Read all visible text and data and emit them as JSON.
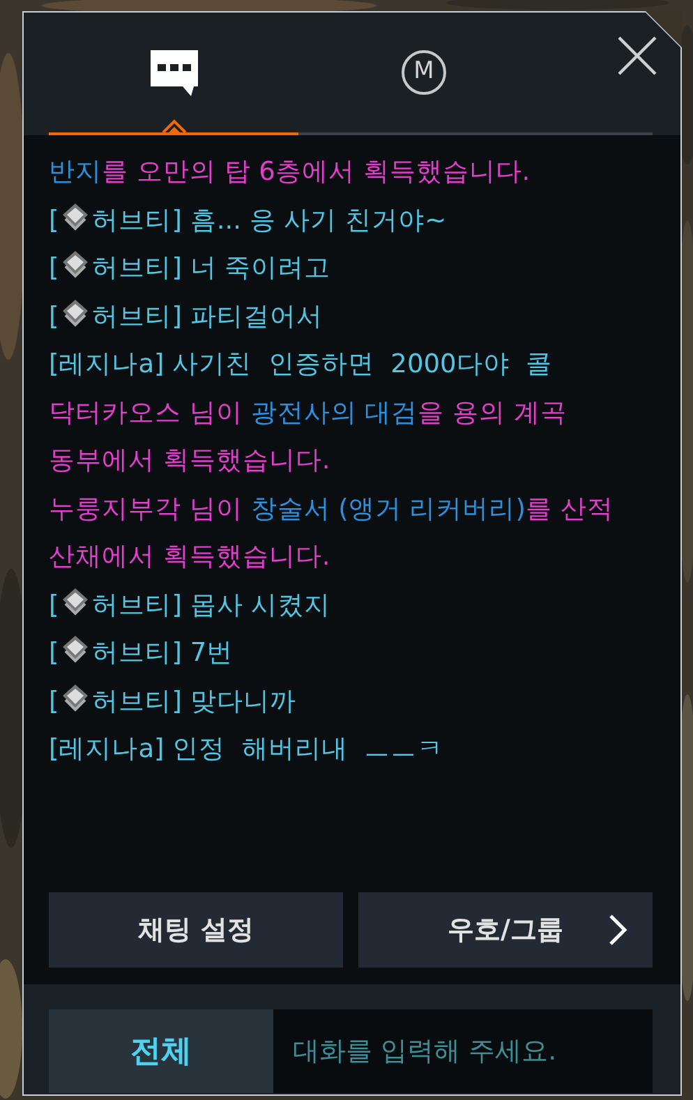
{
  "tabs": [
    {
      "kind": "chat",
      "selected": true
    },
    {
      "kind": "letter",
      "label": "M",
      "selected": false
    }
  ],
  "messages": [
    {
      "kind": "system",
      "segments": [
        {
          "text": "반지",
          "color": "#2e90dc"
        },
        {
          "text": "를 오만의 탑 6층에서 획득했습니다.",
          "color": "#e23fcb"
        }
      ]
    },
    {
      "kind": "chat",
      "rank_icon": true,
      "open": "[",
      "sender": "허브티]",
      "text": "흠... 응 사기 친거야~",
      "color": "#52c6e2"
    },
    {
      "kind": "chat",
      "rank_icon": true,
      "open": "[",
      "sender": "허브티]",
      "text": "너 죽이려고",
      "color": "#52c6e2"
    },
    {
      "kind": "chat",
      "rank_icon": true,
      "open": "[",
      "sender": "허브티]",
      "text": "파티걸어서",
      "color": "#52c6e2"
    },
    {
      "kind": "chat",
      "rank_icon": false,
      "text": "[레지나a] 사기친  인증하면  2000다야  콜",
      "color": "#52c6e2"
    },
    {
      "kind": "system",
      "segments": [
        {
          "text": "닥터카오스 님이 ",
          "color": "#e23fcb"
        },
        {
          "text": "광전사의 대검",
          "color": "#2e90dc"
        },
        {
          "text": "을 용의 계곡 동부에서 획득했습니다.",
          "color": "#e23fcb"
        }
      ]
    },
    {
      "kind": "system",
      "segments": [
        {
          "text": "누룽지부각 님이 ",
          "color": "#e23fcb"
        },
        {
          "text": "창술서 (앵거 리커버리)",
          "color": "#2e90dc"
        },
        {
          "text": "를 산적 산채에서 획득했습니다.",
          "color": "#e23fcb"
        }
      ]
    },
    {
      "kind": "chat",
      "rank_icon": true,
      "open": "[",
      "sender": "허브티]",
      "text": "몹사 시켰지",
      "color": "#52c6e2"
    },
    {
      "kind": "chat",
      "rank_icon": true,
      "open": "[",
      "sender": "허브티]",
      "text": "7번",
      "color": "#52c6e2"
    },
    {
      "kind": "chat",
      "rank_icon": true,
      "open": "[",
      "sender": "허브티]",
      "text": "맞다니까",
      "color": "#52c6e2"
    },
    {
      "kind": "chat",
      "rank_icon": false,
      "text": "[레지나a] 인정  해버리내  ㅡㅡㅋ",
      "color": "#52c6e2"
    }
  ],
  "buttons": [
    {
      "label": "채팅 설정",
      "arrow": false
    },
    {
      "label": "우호/그룹",
      "arrow": true
    }
  ],
  "channel": "전체",
  "input": {
    "placeholder": "대화를 입력해 주세요."
  }
}
